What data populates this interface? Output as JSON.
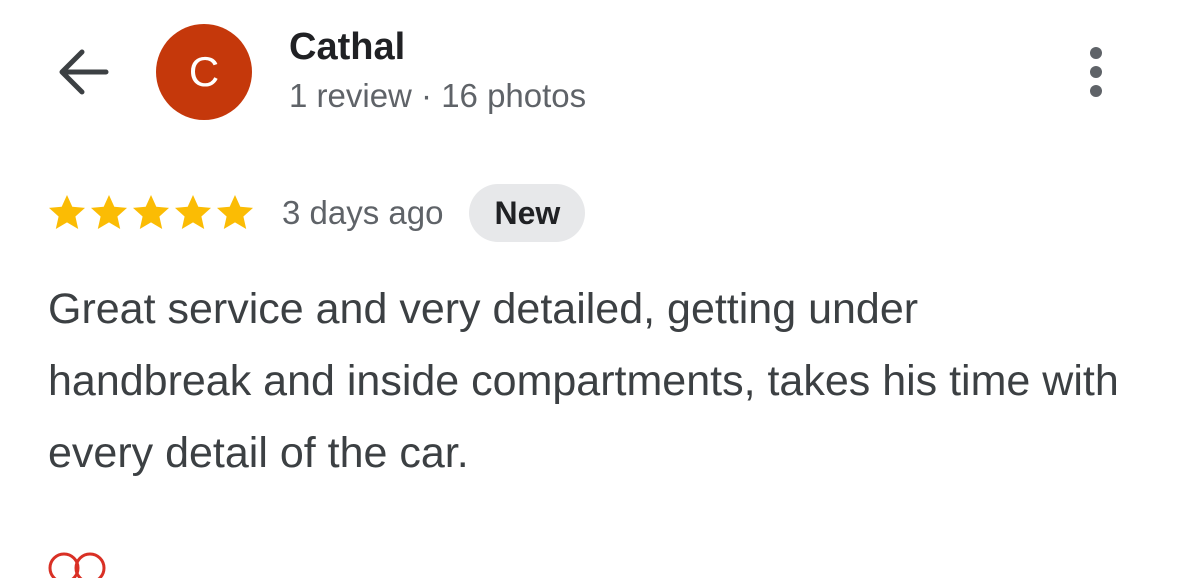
{
  "header": {
    "back_icon": "arrow-left-icon",
    "avatar_letter": "C",
    "avatar_color": "#c5380b",
    "reviewer_name": "Cathal",
    "reviewer_meta": "1 review · 16 photos",
    "more_icon": "more-vertical-icon"
  },
  "review": {
    "rating": 5,
    "rating_max": 5,
    "star_color": "#fbbc04",
    "date": "3 days ago",
    "badge": "New",
    "text": "Great service and very detailed, getting under handbreak and inside compartments, takes his time with every detail of the car."
  },
  "colors": {
    "badge_bg": "#e7e8ea",
    "secondary_text": "#5f6368",
    "body_text": "#3c4043"
  }
}
